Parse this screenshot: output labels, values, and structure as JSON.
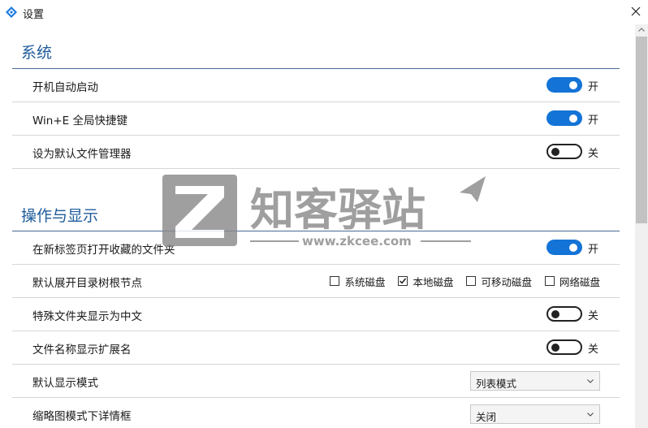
{
  "window": {
    "title": "设置"
  },
  "sections": [
    {
      "title": "系统"
    },
    {
      "title": "操作与显示"
    }
  ],
  "rows": {
    "autostart": {
      "label": "开机自动启动",
      "state": "开",
      "on": true
    },
    "winE": {
      "label": "Win+E 全局快捷键",
      "state": "开",
      "on": true
    },
    "default_fm": {
      "label": "设为默认文件管理器",
      "state": "关",
      "on": false
    },
    "open_fav_newtab": {
      "label": "在新标签页打开收藏的文件夹",
      "state": "开",
      "on": true
    },
    "expand_tree": {
      "label": "默认展开目录树根节点",
      "options": [
        {
          "label": "系统磁盘",
          "checked": false
        },
        {
          "label": "本地磁盘",
          "checked": true
        },
        {
          "label": "可移动磁盘",
          "checked": false
        },
        {
          "label": "网络磁盘",
          "checked": false
        }
      ]
    },
    "special_cn": {
      "label": "特殊文件夹显示为中文",
      "state": "关",
      "on": false
    },
    "show_ext": {
      "label": "文件名称显示扩展名",
      "state": "关",
      "on": false
    },
    "view_mode": {
      "label": "默认显示模式",
      "value": "列表模式"
    },
    "thumb_detail": {
      "label": "缩略图模式下详情框",
      "value": "关闭"
    }
  },
  "watermark": {
    "text": "知客驿站",
    "url": "www.zkcee.com"
  },
  "colors": {
    "accent": "#1373d6",
    "section_title": "#1e5b9b"
  }
}
